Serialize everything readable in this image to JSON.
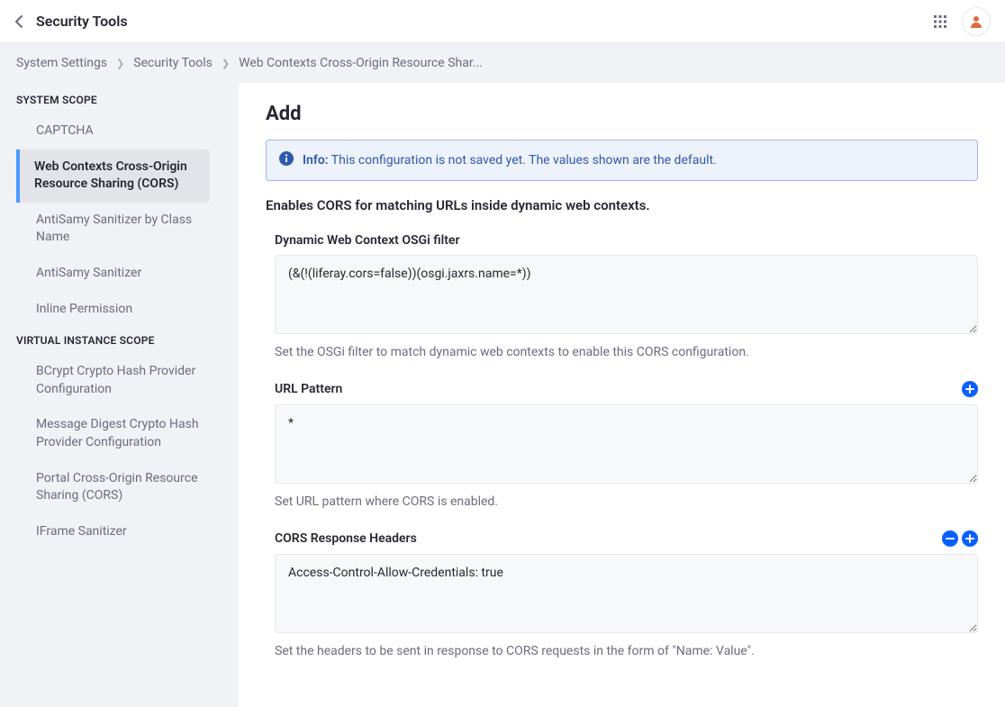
{
  "header": {
    "title": "Security Tools"
  },
  "breadcrumb": [
    "System Settings",
    "Security Tools",
    "Web Contexts Cross-Origin Resource Shar..."
  ],
  "sidebar": {
    "system_scope_label": "SYSTEM SCOPE",
    "virtual_scope_label": "VIRTUAL INSTANCE SCOPE",
    "system_items": [
      "CAPTCHA",
      "Web Contexts Cross-Origin Resource Sharing (CORS)",
      "AntiSamy Sanitizer by Class Name",
      "AntiSamy Sanitizer",
      "Inline Permission"
    ],
    "virtual_items": [
      "BCrypt Crypto Hash Provider Configuration",
      "Message Digest Crypto Hash Provider Configuration",
      "Portal Cross-Origin Resource Sharing (CORS)",
      "IFrame Sanitizer"
    ]
  },
  "main": {
    "heading": "Add",
    "info_label": "Info:",
    "info_text": "This configuration is not saved yet. The values shown are the default.",
    "description": "Enables CORS for matching URLs inside dynamic web contexts.",
    "fields": {
      "osgi": {
        "label": "Dynamic Web Context OSGi filter",
        "value": "(&(!(liferay.cors=false))(osgi.jaxrs.name=*))",
        "help": "Set the OSGi filter to match dynamic web contexts to enable this CORS configuration."
      },
      "url": {
        "label": "URL Pattern",
        "value": "*",
        "help": "Set URL pattern where CORS is enabled."
      },
      "headers": {
        "label": "CORS Response Headers",
        "value": "Access-Control-Allow-Credentials: true",
        "help": "Set the headers to be sent in response to CORS requests in the form of \"Name: Value\"."
      }
    }
  }
}
